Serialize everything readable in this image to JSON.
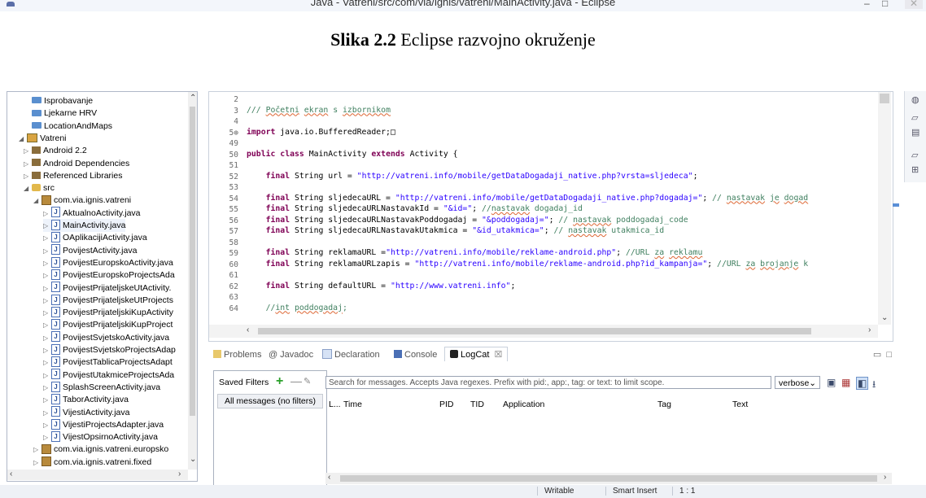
{
  "window": {
    "title": "Java - Vatreni/src/com/via/ignis/vatreni/MainActivity.java - Eclipse"
  },
  "caption": {
    "label": "Slika 2.2",
    "text": " Eclipse razvojno okruženje"
  },
  "explorer": {
    "items": [
      {
        "depth": 1,
        "twisty": "",
        "icon": "folder",
        "label": "Isprobavanje"
      },
      {
        "depth": 1,
        "twisty": "",
        "icon": "folder",
        "label": "Ljekarne HRV"
      },
      {
        "depth": 1,
        "twisty": "",
        "icon": "folder",
        "label": "LocationAndMaps"
      },
      {
        "depth": 0,
        "twisty": "◢",
        "icon": "project",
        "label": "Vatreni"
      },
      {
        "depth": 1,
        "twisty": "▷",
        "icon": "lib",
        "label": "Android 2.2"
      },
      {
        "depth": 1,
        "twisty": "▷",
        "icon": "lib",
        "label": "Android Dependencies"
      },
      {
        "depth": 1,
        "twisty": "▷",
        "icon": "lib",
        "label": "Referenced Libraries"
      },
      {
        "depth": 1,
        "twisty": "◢",
        "icon": "src",
        "label": "src"
      },
      {
        "depth": 2,
        "twisty": "◢",
        "icon": "pkg",
        "label": "com.via.ignis.vatreni"
      },
      {
        "depth": 3,
        "twisty": "▷",
        "icon": "java",
        "label": "AktualnoActivity.java"
      },
      {
        "depth": 3,
        "twisty": "▷",
        "icon": "java",
        "label": "MainActivity.java"
      },
      {
        "depth": 3,
        "twisty": "▷",
        "icon": "java",
        "label": "OAplikacijiActivity.java"
      },
      {
        "depth": 3,
        "twisty": "▷",
        "icon": "java",
        "label": "PovijestActivity.java"
      },
      {
        "depth": 3,
        "twisty": "▷",
        "icon": "java",
        "label": "PovijestEuropskoActivity.java"
      },
      {
        "depth": 3,
        "twisty": "▷",
        "icon": "java",
        "label": "PovijestEuropskoProjectsAda"
      },
      {
        "depth": 3,
        "twisty": "▷",
        "icon": "java",
        "label": "PovijestPrijateljskeUtActivity."
      },
      {
        "depth": 3,
        "twisty": "▷",
        "icon": "java",
        "label": "PovijestPrijateljskeUtProjects"
      },
      {
        "depth": 3,
        "twisty": "▷",
        "icon": "java",
        "label": "PovijestPrijateljskiKupActivity"
      },
      {
        "depth": 3,
        "twisty": "▷",
        "icon": "java",
        "label": "PovijestPrijateljskiKupProject"
      },
      {
        "depth": 3,
        "twisty": "▷",
        "icon": "java",
        "label": "PovijestSvjetskoActivity.java"
      },
      {
        "depth": 3,
        "twisty": "▷",
        "icon": "java",
        "label": "PovijestSvjetskoProjectsAdap"
      },
      {
        "depth": 3,
        "twisty": "▷",
        "icon": "java",
        "label": "PovijestTablicaProjectsAdapt"
      },
      {
        "depth": 3,
        "twisty": "▷",
        "icon": "java",
        "label": "PovijestUtakmiceProjectsAda"
      },
      {
        "depth": 3,
        "twisty": "▷",
        "icon": "java",
        "label": "SplashScreenActivity.java"
      },
      {
        "depth": 3,
        "twisty": "▷",
        "icon": "java",
        "label": "TaborActivity.java"
      },
      {
        "depth": 3,
        "twisty": "▷",
        "icon": "java",
        "label": "VijestiActivity.java"
      },
      {
        "depth": 3,
        "twisty": "▷",
        "icon": "java",
        "label": "VijestiProjectsAdapter.java"
      },
      {
        "depth": 3,
        "twisty": "▷",
        "icon": "java",
        "label": "VijestOpsirnoActivity.java"
      },
      {
        "depth": 2,
        "twisty": "▷",
        "icon": "pkg",
        "label": "com.via.ignis.vatreni.europsko"
      },
      {
        "depth": 2,
        "twisty": "▷",
        "icon": "pkg",
        "label": "com.via.ignis.vatreni.fixed"
      }
    ]
  },
  "editor": {
    "lines": [
      {
        "n": "2",
        "parts": []
      },
      {
        "n": "3",
        "parts": [
          {
            "t": "/// ",
            "c": "com"
          },
          {
            "t": "Početni",
            "c": "com sp"
          },
          {
            "t": " ",
            "c": "com"
          },
          {
            "t": "ekran",
            "c": "com sp"
          },
          {
            "t": " s ",
            "c": "com"
          },
          {
            "t": "izbornikom",
            "c": "com sp"
          }
        ]
      },
      {
        "n": "4",
        "parts": []
      },
      {
        "n": "5⊕",
        "parts": [
          {
            "t": "import",
            "c": "kw"
          },
          {
            "t": " java.io.BufferedReader;",
            "c": ""
          },
          {
            "t": "□",
            "c": ""
          }
        ]
      },
      {
        "n": "49",
        "parts": []
      },
      {
        "n": "50",
        "parts": [
          {
            "t": "public",
            "c": "kw"
          },
          {
            "t": " ",
            "c": ""
          },
          {
            "t": "class",
            "c": "kw"
          },
          {
            "t": " MainActivity ",
            "c": ""
          },
          {
            "t": "extends",
            "c": "kw"
          },
          {
            "t": " Activity {",
            "c": ""
          }
        ]
      },
      {
        "n": "51",
        "parts": []
      },
      {
        "n": "52",
        "parts": [
          {
            "t": "    ",
            "c": ""
          },
          {
            "t": "final",
            "c": "kw"
          },
          {
            "t": " String url = ",
            "c": ""
          },
          {
            "t": "\"http://vatreni.info/mobile/getDataDogadaji_native.php?vrsta=sljedeca\"",
            "c": "str"
          },
          {
            "t": ";",
            "c": ""
          }
        ]
      },
      {
        "n": "53",
        "parts": []
      },
      {
        "n": "54",
        "parts": [
          {
            "t": "    ",
            "c": ""
          },
          {
            "t": "final",
            "c": "kw"
          },
          {
            "t": " String sljedecaURL = ",
            "c": ""
          },
          {
            "t": "\"http://vatreni.info/mobile/getDataDogadaji_native.php?dogadaj=\"",
            "c": "str"
          },
          {
            "t": "; ",
            "c": ""
          },
          {
            "t": "// ",
            "c": "com"
          },
          {
            "t": "nastavak",
            "c": "com sp"
          },
          {
            "t": " ",
            "c": "com"
          },
          {
            "t": "je",
            "c": "com sp"
          },
          {
            "t": " ",
            "c": "com"
          },
          {
            "t": "dogad",
            "c": "com sp"
          }
        ]
      },
      {
        "n": "55",
        "parts": [
          {
            "t": "    ",
            "c": ""
          },
          {
            "t": "final",
            "c": "kw"
          },
          {
            "t": " String sljedecaURLNastavakId = ",
            "c": ""
          },
          {
            "t": "\"&id=\"",
            "c": "str"
          },
          {
            "t": "; ",
            "c": ""
          },
          {
            "t": "//",
            "c": "com"
          },
          {
            "t": "nastavak",
            "c": "com sp"
          },
          {
            "t": " dogadaj_id",
            "c": "com"
          }
        ]
      },
      {
        "n": "56",
        "parts": [
          {
            "t": "    ",
            "c": ""
          },
          {
            "t": "final",
            "c": "kw"
          },
          {
            "t": " String sljedecaURLNastavakPoddogadaj = ",
            "c": ""
          },
          {
            "t": "\"&poddogadaj=\"",
            "c": "str"
          },
          {
            "t": "; ",
            "c": ""
          },
          {
            "t": "// ",
            "c": "com"
          },
          {
            "t": "nastavak",
            "c": "com sp"
          },
          {
            "t": " poddogadaj_code",
            "c": "com"
          }
        ]
      },
      {
        "n": "57",
        "parts": [
          {
            "t": "    ",
            "c": ""
          },
          {
            "t": "final",
            "c": "kw"
          },
          {
            "t": " String sljedecaURLNastavakUtakmica = ",
            "c": ""
          },
          {
            "t": "\"&id_utakmica=\"",
            "c": "str"
          },
          {
            "t": "; ",
            "c": ""
          },
          {
            "t": "// ",
            "c": "com"
          },
          {
            "t": "nastavak",
            "c": "com sp"
          },
          {
            "t": " utakmica_id",
            "c": "com"
          }
        ]
      },
      {
        "n": "58",
        "parts": []
      },
      {
        "n": "59",
        "parts": [
          {
            "t": "    ",
            "c": ""
          },
          {
            "t": "final",
            "c": "kw"
          },
          {
            "t": " String reklamaURL =",
            "c": ""
          },
          {
            "t": "\"http://vatreni.info/mobile/reklame-android.php\"",
            "c": "str"
          },
          {
            "t": "; ",
            "c": ""
          },
          {
            "t": "//URL ",
            "c": "com"
          },
          {
            "t": "za",
            "c": "com sp"
          },
          {
            "t": " ",
            "c": "com"
          },
          {
            "t": "reklamu",
            "c": "com sp"
          }
        ]
      },
      {
        "n": "60",
        "parts": [
          {
            "t": "    ",
            "c": ""
          },
          {
            "t": "final",
            "c": "kw"
          },
          {
            "t": " String reklamaURLzapis = ",
            "c": ""
          },
          {
            "t": "\"http://vatreni.info/mobile/reklame-android.php?id_kampanja=\"",
            "c": "str"
          },
          {
            "t": "; ",
            "c": ""
          },
          {
            "t": "//URL ",
            "c": "com"
          },
          {
            "t": "za",
            "c": "com sp"
          },
          {
            "t": " ",
            "c": "com"
          },
          {
            "t": "brojanje",
            "c": "com sp"
          },
          {
            "t": " k",
            "c": "com"
          }
        ]
      },
      {
        "n": "61",
        "parts": []
      },
      {
        "n": "62",
        "parts": [
          {
            "t": "    ",
            "c": ""
          },
          {
            "t": "final",
            "c": "kw"
          },
          {
            "t": " String defaultURL = ",
            "c": ""
          },
          {
            "t": "\"http://www.vatreni.info\"",
            "c": "str"
          },
          {
            "t": ";",
            "c": ""
          }
        ]
      },
      {
        "n": "63",
        "parts": []
      },
      {
        "n": "64",
        "parts": [
          {
            "t": "    ",
            "c": ""
          },
          {
            "t": "//",
            "c": "com"
          },
          {
            "t": "int",
            "c": "com sp"
          },
          {
            "t": " ",
            "c": "com"
          },
          {
            "t": "poddogadaj",
            "c": "com sp"
          },
          {
            "t": ";",
            "c": "com"
          }
        ]
      }
    ]
  },
  "views": {
    "tabs": [
      "Problems",
      "Javadoc",
      "Declaration",
      "Console",
      "LogCat"
    ],
    "active_tab": "LogCat"
  },
  "logcat": {
    "saved_filters_label": "Saved Filters",
    "all_messages": "All messages (no filters)",
    "search_placeholder": "Search for messages. Accepts Java regexes. Prefix with pid:, app:, tag: or text: to limit scope.",
    "level": "verbose",
    "columns": [
      "L...",
      "Time",
      "PID",
      "TID",
      "Application",
      "Tag",
      "Text"
    ]
  },
  "status": {
    "writable": "Writable",
    "insert_mode": "Smart Insert",
    "position": "1 : 1"
  },
  "colors": {
    "keyword": "#7f0055",
    "string": "#2a00ff",
    "comment": "#3f7f5f"
  }
}
